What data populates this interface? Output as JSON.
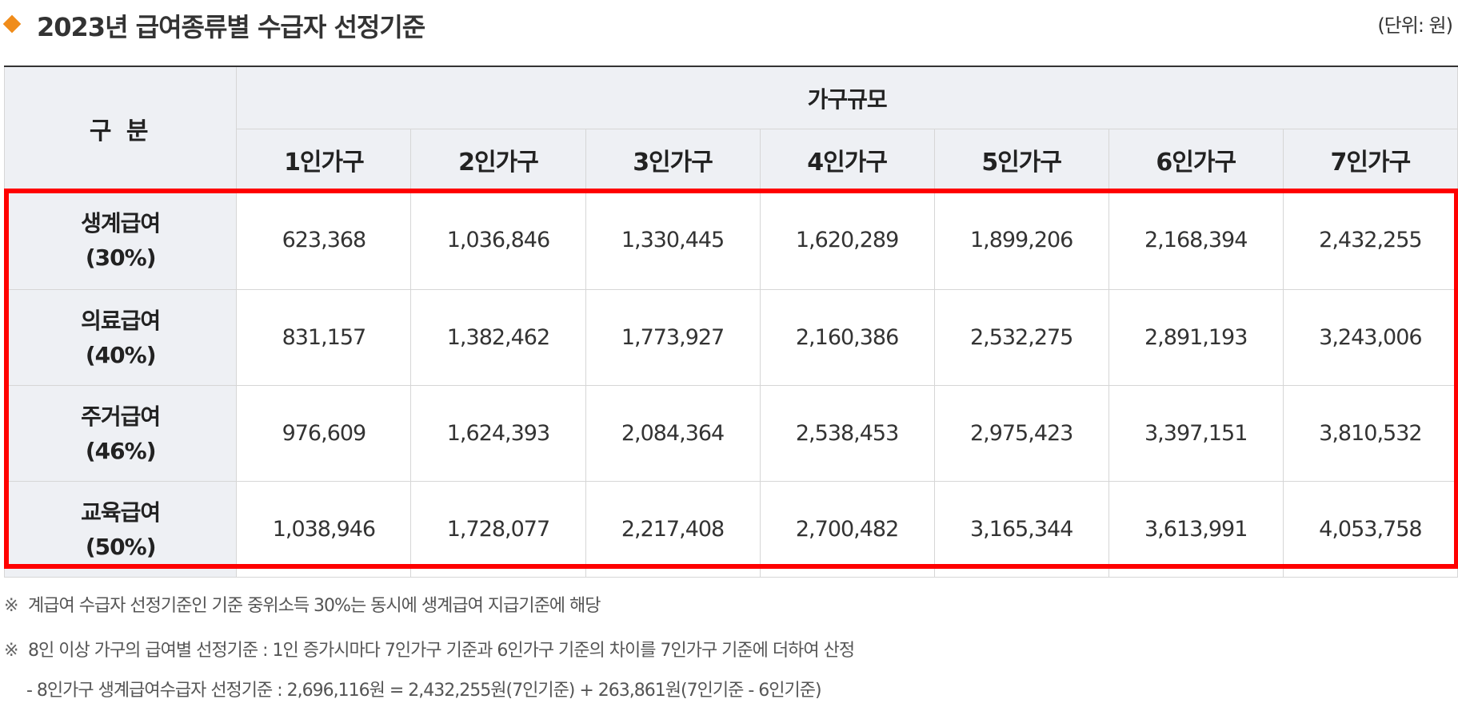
{
  "header": {
    "title": "2023년 급여종류별 수급자 선정기준",
    "unit": "(단위: 원)",
    "accent_color": "#f08c1a",
    "icon": "diamond-bullet-icon"
  },
  "table": {
    "corner_label": "구 분",
    "group_label": "가구규모",
    "household_sizes": [
      "1인가구",
      "2인가구",
      "3인가구",
      "4인가구",
      "5인가구",
      "6인가구",
      "7인가구"
    ],
    "rows": [
      {
        "name": "생계급여",
        "pct": "(30%)",
        "values": [
          "623,368",
          "1,036,846",
          "1,330,445",
          "1,620,289",
          "1,899,206",
          "2,168,394",
          "2,432,255"
        ]
      },
      {
        "name": "의료급여",
        "pct": "(40%)",
        "values": [
          "831,157",
          "1,382,462",
          "1,773,927",
          "2,160,386",
          "2,532,275",
          "2,891,193",
          "3,243,006"
        ]
      },
      {
        "name": "주거급여",
        "pct": "(46%)",
        "values": [
          "976,609",
          "1,624,393",
          "2,084,364",
          "2,538,453",
          "2,975,423",
          "3,397,151",
          "3,810,532"
        ]
      },
      {
        "name": "교육급여",
        "pct": "(50%)",
        "values": [
          "1,038,946",
          "1,728,077",
          "2,217,408",
          "2,700,482",
          "3,165,344",
          "3,613,991",
          "4,053,758"
        ]
      }
    ],
    "highlight_color": "#ff0000"
  },
  "notes": {
    "mark": "※",
    "note1": "계급여 수급자 선정기준인 기준 중위소득 30%는 동시에 생계급여 지급기준에 해당",
    "note2": "8인 이상 가구의 급여별 선정기준 : 1인 증가시마다 7인가구 기준과 6인가구 기준의 차이를 7인가구 기준에 더하여 산정",
    "note3": "- 8인가구 생계급여수급자 선정기준 : 2,696,116원 = 2,432,255원(7인기준) + 263,861원(7인기준 - 6인기준)"
  }
}
